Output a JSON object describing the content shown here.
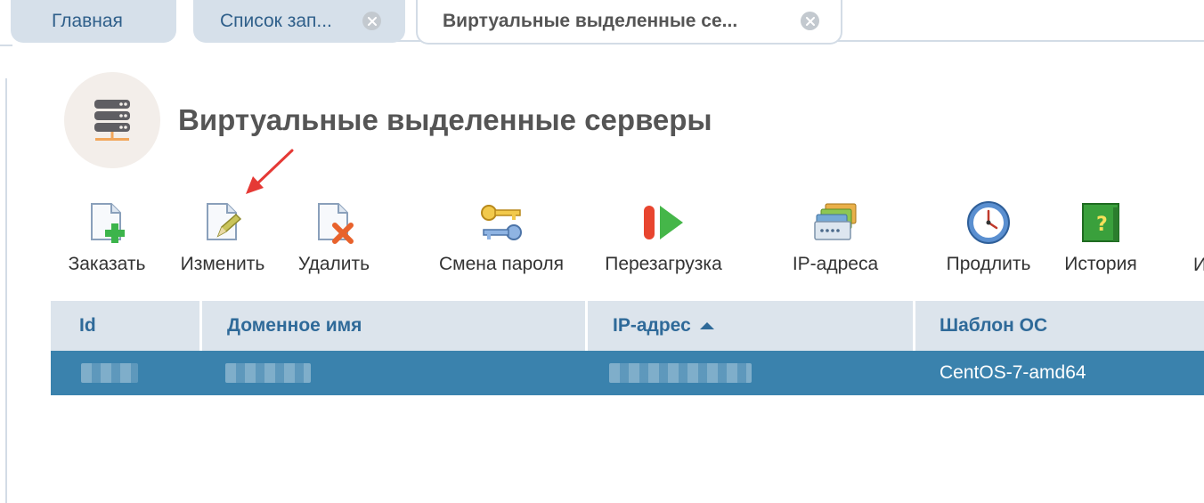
{
  "tabs": [
    {
      "label": "Главная",
      "closable": false,
      "active": false
    },
    {
      "label": "Список зап...",
      "closable": true,
      "active": false
    },
    {
      "label": "Виртуальные выделенные се...",
      "closable": true,
      "active": true
    }
  ],
  "page": {
    "title": "Виртуальные выделенные серверы",
    "icon": "server-stack-icon"
  },
  "toolbar": {
    "order": "Заказать",
    "edit": "Изменить",
    "delete": "Удалить",
    "change_password": "Смена пароля",
    "reboot": "Перезагрузка",
    "ip_addresses": "IP-адреса",
    "renew": "Продлить",
    "history": "История",
    "cut": "И"
  },
  "table": {
    "columns": [
      "Id",
      "Доменное имя",
      "IP-адрес",
      "Шаблон ОС"
    ],
    "sort_column": "IP-адрес",
    "sort_direction": "asc",
    "rows": [
      {
        "id": "",
        "domain": "",
        "ip": "",
        "os_template": "CentOS-7-amd64",
        "selected": true
      }
    ]
  },
  "colors": {
    "accent": "#3a82ad",
    "header_bg": "#dce4ec",
    "tab_bg": "#d6e0ea",
    "annotation_arrow": "#e53935"
  }
}
